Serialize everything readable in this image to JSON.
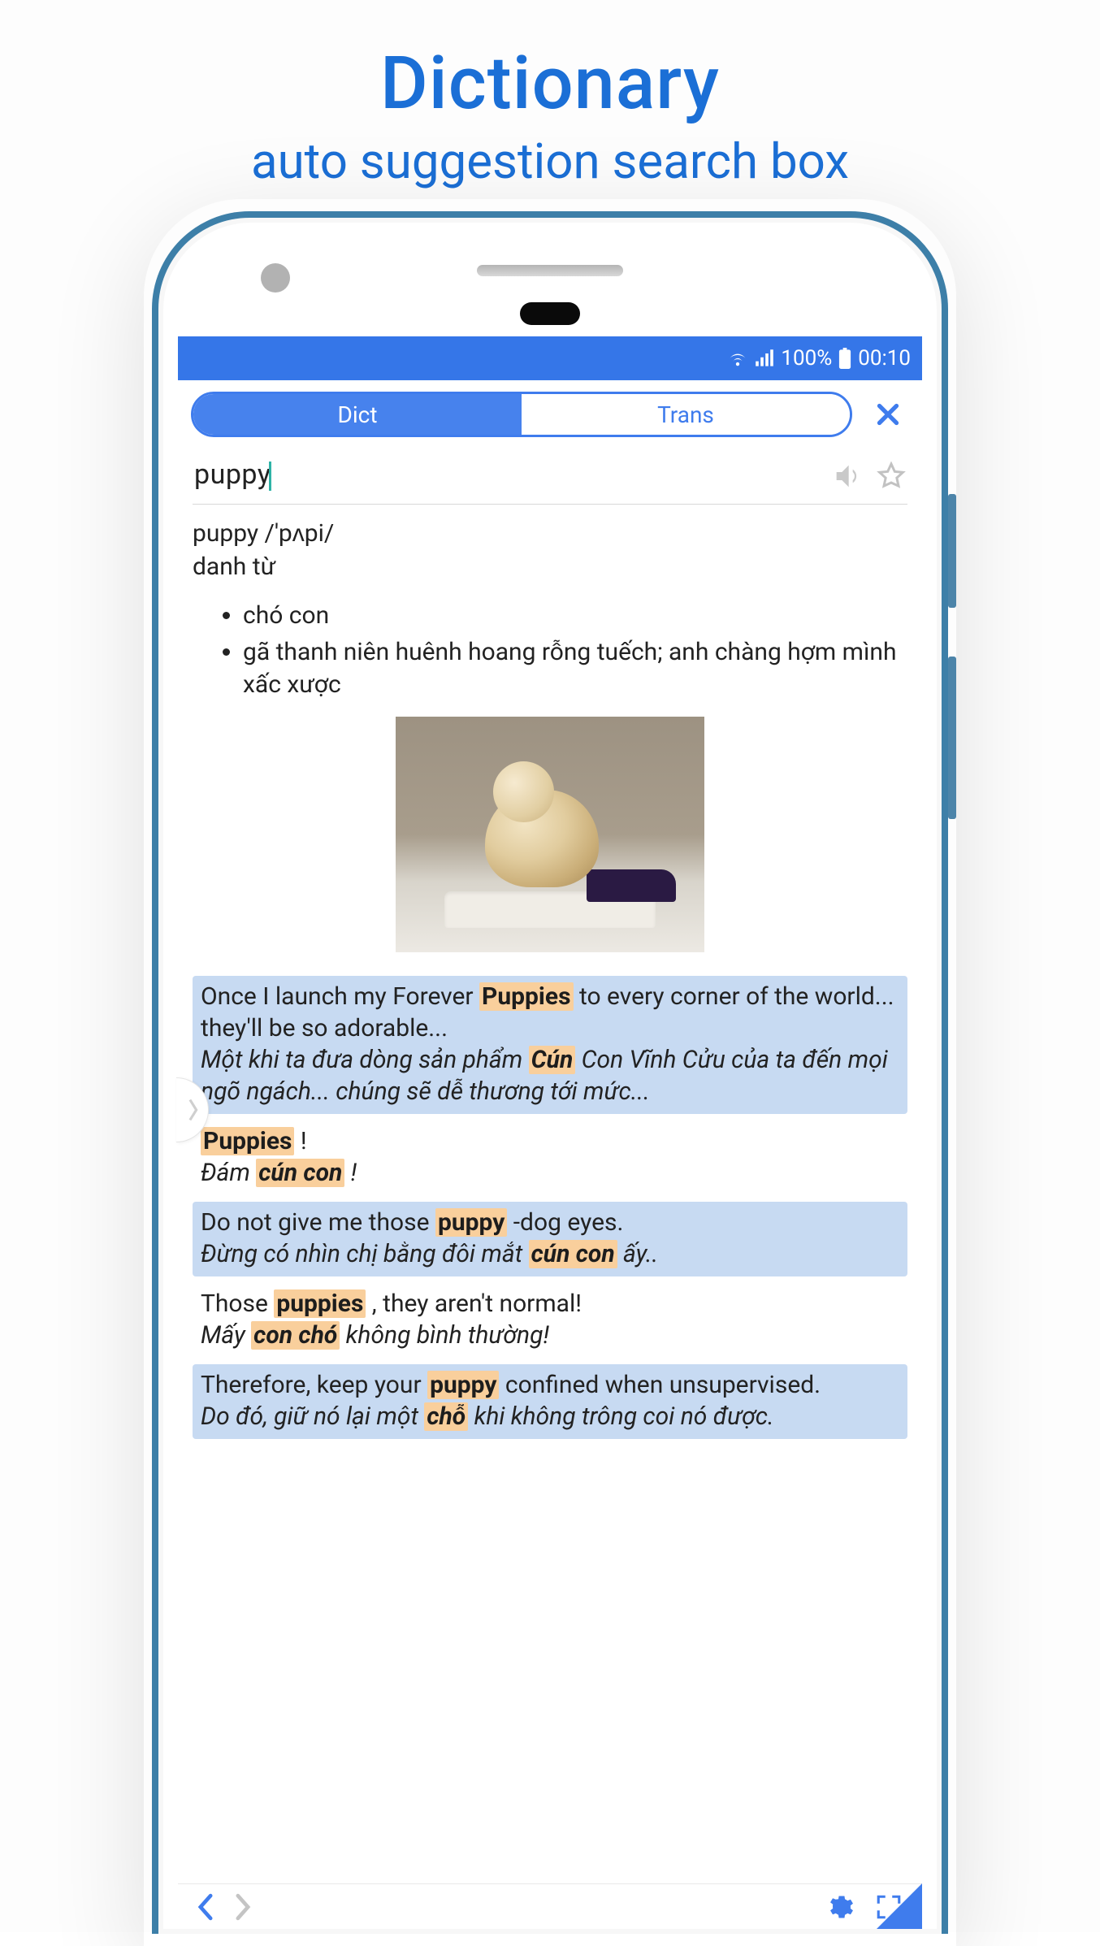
{
  "caption": {
    "title": "Dictionary",
    "subtitle": "auto suggestion search box"
  },
  "statusbar": {
    "battery_pct": "100%",
    "clock": "00:10"
  },
  "segment": {
    "dict_label": "Dict",
    "trans_label": "Trans"
  },
  "search": {
    "query": "puppy"
  },
  "entry": {
    "headword_line": "puppy /'pʌpi/",
    "pos": "danh từ",
    "definitions": [
      "chó con",
      "gã thanh niên huênh hoang rỗng tuếch; anh chàng hợm mình xấc xược"
    ]
  },
  "examples": [
    {
      "style": "alt",
      "en_parts": [
        "Once I launch my Forever ",
        {
          "hl": "Puppies"
        },
        " to every corner of the world... they'll be so adorable..."
      ],
      "vi_parts": [
        "Một khi ta đưa dòng sản phẩm ",
        {
          "hl": "Cún"
        },
        " Con Vĩnh Cửu của ta đến mọi ngõ ngách... chúng sẽ dễ thương tới mức..."
      ]
    },
    {
      "style": "plain",
      "en_parts": [
        {
          "hl": "Puppies"
        },
        " !"
      ],
      "vi_parts": [
        "Đám ",
        {
          "hl": "cún con"
        },
        " !"
      ]
    },
    {
      "style": "alt",
      "en_parts": [
        "Do not give me those ",
        {
          "hl": "puppy"
        },
        " -dog eyes."
      ],
      "vi_parts": [
        "Đừng có nhìn chị bằng đôi mắt ",
        {
          "hl": "cún con"
        },
        " ấy.."
      ]
    },
    {
      "style": "plain",
      "en_parts": [
        "Those ",
        {
          "hl": "puppies"
        },
        " , they aren't normal!"
      ],
      "vi_parts": [
        "Mấy ",
        {
          "hl": "con chó"
        },
        " không bình thường!"
      ]
    },
    {
      "style": "alt",
      "en_parts": [
        "Therefore, keep your ",
        {
          "hl": "puppy"
        },
        " confined when unsupervised."
      ],
      "vi_parts": [
        "Do đó, giữ nó lại một ",
        {
          "hl": "chỗ"
        },
        " khi không trông coi nó được."
      ]
    }
  ]
}
